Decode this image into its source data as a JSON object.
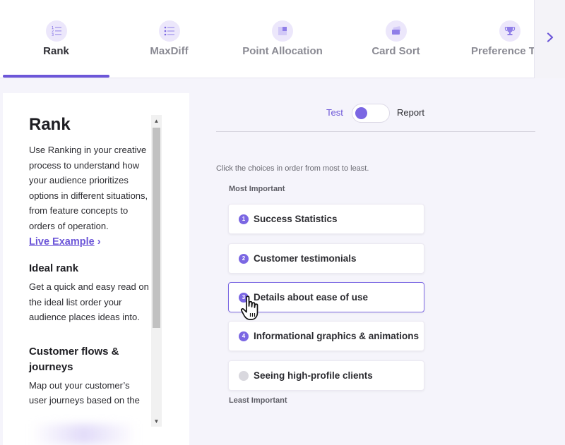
{
  "tabs": [
    {
      "label": "Rank",
      "icon": "rank-list-icon",
      "active": true
    },
    {
      "label": "MaxDiff",
      "icon": "maxdiff-list-icon",
      "active": false
    },
    {
      "label": "Point Allocation",
      "icon": "point-allocation-icon",
      "active": false
    },
    {
      "label": "Card Sort",
      "icon": "card-sort-icon",
      "active": false
    },
    {
      "label": "Preference Te",
      "icon": "trophy-icon",
      "active": false
    }
  ],
  "tab_next_icon": "chevron-right-icon",
  "colors": {
    "accent": "#6c56d8",
    "knob": "#7b67e3"
  },
  "side": {
    "title": "Rank",
    "intro": "Use Ranking in your creative process to understand how your audience prioritizes options in different situations, from feature concepts to orders of operation.",
    "link_label": "Live Example",
    "link_chevron": "›",
    "sections": [
      {
        "heading": "Ideal rank",
        "body": "Get a quick and easy read on the ideal list order your audience places ideas into."
      },
      {
        "heading": "Customer flows & journeys",
        "body": "Map out your customer’s user journeys based on the"
      }
    ]
  },
  "demo": {
    "toggle": {
      "left_label": "Test",
      "right_label": "Report",
      "state": "Test"
    },
    "instruction": "Click the choices in order from most to least.",
    "most_label": "Most Important",
    "least_label": "Least Important",
    "choices": [
      {
        "rank": "1",
        "label": "Success Statistics"
      },
      {
        "rank": "2",
        "label": "Customer testimonials"
      },
      {
        "rank": "3",
        "label": "Details about ease of use"
      },
      {
        "rank": "4",
        "label": "Informational graphics & animations"
      },
      {
        "rank": "",
        "label": "Seeing high-profile clients"
      }
    ]
  }
}
